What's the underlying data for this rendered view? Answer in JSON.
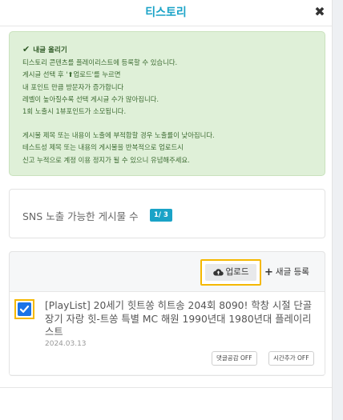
{
  "header": {
    "title": "티스토리",
    "close_label": "✖"
  },
  "notice": {
    "title": "내글 올리기",
    "lines": [
      "티스토리 콘텐츠를 플레이리스트에 등록할 수 있습니다.",
      "게시글 선택 후 '⬆업로드'를 누르면",
      "내 포인트 만큼 방문자가 증가합니다",
      "레벨이 높아질수록 선택 게시글 수가 많아집니다.",
      "1회 노출시 1뷰포인트가 소모됩니다."
    ],
    "warning_lines": [
      "게시물 제목 또는 내용이 노출에 부적합할 경우 노출률이 낮아집니다.",
      "테스트성 제목 또는 내용의 게시물을 반복적으로 업로드시",
      "신고 누적으로 계정 이용 정지가 될 수 있으니 유념해주세요."
    ]
  },
  "sns": {
    "label": "SNS 노출 가능한 게시물 수",
    "badge": "1/ 3"
  },
  "toolbar": {
    "upload_label": "업로드",
    "new_post_label": "새글 등록"
  },
  "posts": [
    {
      "title": "[PlayList] 20세기 힛트쏭 히트송 204회 8090! 학창 시절 단골 장기 자랑 힛-트쏭 특별 MC 해원 1990년대 1980년대 플레이리스트",
      "date": "2024.03.13",
      "checked": true,
      "comment_toggle": "댓글공감 OFF",
      "time_toggle": "시간추가 OFF"
    }
  ],
  "colors": {
    "accent": "#1aa3c7",
    "highlight": "#f5b800",
    "notice_bg": "#dff0d8",
    "checkbox": "#1a73e8"
  }
}
